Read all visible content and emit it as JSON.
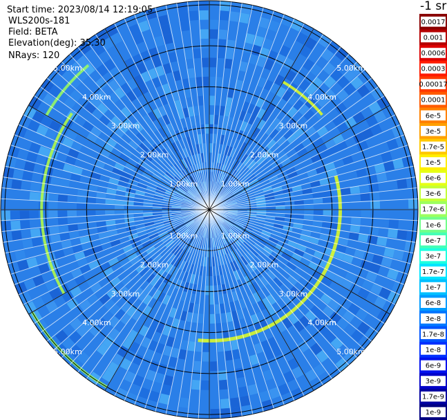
{
  "header": {
    "start_time_label": "Start time: 2023/08/14 12:19:05",
    "instrument": "WLS200s-181",
    "field": "Field: BETA",
    "elevation": "Elevation(deg): 35.30",
    "nrays": "NRays: 120"
  },
  "plot": {
    "range_rings_km": [
      1,
      2,
      3,
      4,
      5
    ],
    "ring_labels": [
      "1.00km",
      "2.00km",
      "3.00km",
      "4.00km",
      "5.00km"
    ],
    "num_rays": 120,
    "background_color": "#2a7fe8",
    "ring_color": "#000000",
    "label_color": "#ffffff"
  },
  "colorbar": {
    "title": "-1 sr",
    "entries": [
      {
        "label": "0.0017",
        "color": "#8a0000"
      },
      {
        "label": "0.001",
        "color": "#b50000"
      },
      {
        "label": "0.0006",
        "color": "#dd0000"
      },
      {
        "label": "0.0003",
        "color": "#ff1a00"
      },
      {
        "label": "0.00017",
        "color": "#ff3a00"
      },
      {
        "label": "0.0001",
        "color": "#ff5a00"
      },
      {
        "label": "6e-5",
        "color": "#ff8000"
      },
      {
        "label": "3e-5",
        "color": "#ffa000"
      },
      {
        "label": "1.7e-5",
        "color": "#ffc800"
      },
      {
        "label": "1e-5",
        "color": "#ffee00"
      },
      {
        "label": "6e-6",
        "color": "#e6ff14"
      },
      {
        "label": "3e-6",
        "color": "#c4ff36"
      },
      {
        "label": "1.7e-6",
        "color": "#9cff5e"
      },
      {
        "label": "1e-6",
        "color": "#70ff8a"
      },
      {
        "label": "6e-7",
        "color": "#44ffb6"
      },
      {
        "label": "3e-7",
        "color": "#1effe0"
      },
      {
        "label": "1.7e-7",
        "color": "#00e4ff"
      },
      {
        "label": "1e-7",
        "color": "#00c0ff"
      },
      {
        "label": "6e-8",
        "color": "#009cff"
      },
      {
        "label": "3e-8",
        "color": "#0078ff"
      },
      {
        "label": "1.7e-8",
        "color": "#0054ff"
      },
      {
        "label": "1e-8",
        "color": "#0030ff"
      },
      {
        "label": "6e-9",
        "color": "#0010ee"
      },
      {
        "label": "3e-9",
        "color": "#0000c8"
      },
      {
        "label": "1.7e-9",
        "color": "#0000a0"
      },
      {
        "label": "1e-9",
        "color": "#000080"
      }
    ]
  }
}
